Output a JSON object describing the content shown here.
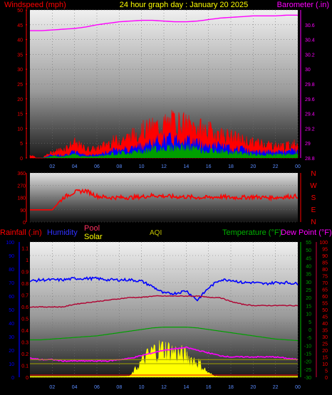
{
  "header": {
    "left_label": "Windspeed (mph)",
    "title": "24 hour graph day : January 20 2025",
    "right_label": "Barometer (.in)"
  },
  "colors": {
    "wind": "#ff0000",
    "gust_fill": "#0000ff",
    "avg_fill": "#00a000",
    "barometer": "#ff00ff",
    "wind_dir": "#ff0000",
    "humidity": "#0000ff",
    "pool": "#b00030",
    "solar": "#ffff00",
    "temperature": "#00a000",
    "dew_point": "#ff00ff",
    "rainfall": "#ffff00",
    "left_axis_text": "#ff0000",
    "rain_axis_text": "#0000ff",
    "temp_axis_text": "#00a000",
    "dew_axis_text": "#ff0000",
    "baro_axis_text": "#ff00ff"
  },
  "chart_data": [
    {
      "type": "area",
      "name": "wind",
      "title": "24 hour graph day : January 20 2025",
      "ylabel": "Windspeed (mph)",
      "y2label": "Barometer (.in)",
      "x_ticks": [
        "02",
        "04",
        "06",
        "08",
        "10",
        "12",
        "14",
        "16",
        "18",
        "20",
        "22",
        "00"
      ],
      "ylim": [
        0,
        50
      ],
      "y_ticks": [
        0,
        5,
        10,
        15,
        20,
        25,
        30,
        35,
        40,
        45,
        50
      ],
      "y2lim": [
        28.8,
        30.8
      ],
      "y2_ticks": [
        "28.8",
        "29",
        "29.2",
        "29.4",
        "29.6",
        "29.8",
        "30",
        "30.2",
        "30.4",
        "30.6"
      ],
      "series": [
        {
          "name": "gust",
          "x": [
            0,
            1,
            2,
            3,
            4,
            5,
            6,
            7,
            8,
            9,
            10,
            11,
            12,
            13,
            14,
            15,
            16,
            17,
            18,
            19,
            20,
            21,
            22,
            23,
            24
          ],
          "values": [
            1,
            0,
            2,
            3,
            5,
            3,
            3,
            5,
            6,
            7,
            9,
            10,
            11,
            12,
            11,
            10,
            9,
            8,
            7,
            6,
            5,
            5,
            4,
            4,
            5
          ]
        },
        {
          "name": "average",
          "x": [
            0,
            1,
            2,
            3,
            4,
            5,
            6,
            7,
            8,
            9,
            10,
            11,
            12,
            13,
            14,
            15,
            16,
            17,
            18,
            19,
            20,
            21,
            22,
            23,
            24
          ],
          "values": [
            0,
            0,
            1,
            1,
            2,
            1,
            1,
            2,
            3,
            3,
            4,
            5,
            6,
            6,
            6,
            5,
            4,
            4,
            3,
            3,
            2,
            2,
            2,
            2,
            3
          ]
        },
        {
          "name": "barometer",
          "x": [
            0,
            1,
            2,
            3,
            4,
            5,
            6,
            7,
            8,
            9,
            10,
            11,
            12,
            13,
            14,
            15,
            16,
            17,
            18,
            19,
            20,
            21,
            22,
            23,
            24
          ],
          "values": [
            30.52,
            30.52,
            30.53,
            30.54,
            30.55,
            30.57,
            30.6,
            30.62,
            30.64,
            30.65,
            30.66,
            30.66,
            30.65,
            30.64,
            30.64,
            30.65,
            30.67,
            30.69,
            30.7,
            30.71,
            30.72,
            30.72,
            30.72,
            30.73,
            30.73
          ]
        }
      ]
    },
    {
      "type": "line",
      "name": "wind_direction",
      "ylim": [
        0,
        360
      ],
      "y_ticks": [
        0,
        90,
        180,
        270,
        360
      ],
      "compass_labels": [
        "N",
        "W",
        "S",
        "E",
        "N"
      ],
      "series": [
        {
          "name": "direction",
          "x": [
            0,
            1,
            2,
            3,
            4,
            5,
            6,
            7,
            8,
            9,
            10,
            11,
            12,
            13,
            14,
            15,
            16,
            17,
            18,
            19,
            20,
            21,
            22,
            23,
            24
          ],
          "values": [
            90,
            90,
            90,
            180,
            220,
            230,
            190,
            180,
            180,
            180,
            185,
            195,
            190,
            185,
            185,
            180,
            180,
            185,
            180,
            180,
            185,
            180,
            180,
            185,
            190
          ]
        }
      ]
    },
    {
      "type": "line",
      "name": "climate",
      "labels": {
        "rainfall": "Rainfall (.in)",
        "humidity": "Humidity",
        "pool": "Pool",
        "solar": "Solar",
        "aqi": "AQI",
        "temperature": "Temperature (°F)",
        "dew_point": "Dew Point (°F)"
      },
      "x_ticks": [
        "02",
        "04",
        "06",
        "08",
        "10",
        "12",
        "14",
        "16",
        "18",
        "20",
        "22",
        "00"
      ],
      "rain_ticks": [
        "0",
        "0.1",
        "0.2",
        "0.3",
        "0.4",
        "0.5",
        "0.6",
        "0.7",
        "0.8",
        "0.9",
        "1",
        "1.1"
      ],
      "humidity_ticks": [
        "0",
        "10",
        "20",
        "30",
        "40",
        "50",
        "60",
        "70",
        "80",
        "90",
        "100"
      ],
      "temp_ticks": [
        "-30",
        "-25",
        "-20",
        "-15",
        "-10",
        "-5",
        "0",
        "5",
        "10",
        "15",
        "20",
        "25",
        "30",
        "35",
        "40",
        "45",
        "50",
        "55"
      ],
      "dew_ticks": [
        "0",
        "5",
        "10",
        "15",
        "20",
        "25",
        "30",
        "35",
        "40",
        "45",
        "50",
        "55",
        "60",
        "65",
        "70",
        "75",
        "80",
        "85",
        "90",
        "95",
        "100"
      ],
      "humidity_lim": [
        0,
        100
      ],
      "temp_lim": [
        -30,
        55
      ],
      "series": [
        {
          "name": "humidity",
          "x": [
            0,
            1,
            2,
            3,
            4,
            5,
            6,
            7,
            8,
            9,
            10,
            11,
            12,
            13,
            14,
            15,
            16,
            17,
            18,
            19,
            20,
            21,
            22,
            23,
            24
          ],
          "values": [
            71,
            72,
            72,
            72,
            73,
            73,
            73,
            72,
            72,
            72,
            71,
            67,
            62,
            62,
            64,
            57,
            66,
            72,
            72,
            70,
            70,
            69,
            70,
            70,
            69
          ]
        },
        {
          "name": "pool",
          "x": [
            0,
            1,
            2,
            3,
            4,
            5,
            6,
            7,
            8,
            9,
            10,
            11,
            12,
            13,
            14,
            15,
            16,
            17,
            18,
            19,
            20,
            21,
            22,
            23,
            24
          ],
          "values": [
            52,
            52,
            52,
            52,
            54,
            55,
            56,
            57,
            58,
            59,
            59,
            60,
            60,
            60,
            60,
            60,
            59,
            59,
            56,
            54,
            53,
            53,
            53,
            53,
            53
          ]
        },
        {
          "name": "temperature",
          "x": [
            0,
            1,
            2,
            3,
            4,
            5,
            6,
            7,
            8,
            9,
            10,
            11,
            12,
            13,
            14,
            15,
            16,
            17,
            18,
            19,
            20,
            21,
            22,
            23,
            24
          ],
          "values": [
            -6.5,
            -6.5,
            -6,
            -5.5,
            -5,
            -4.5,
            -4,
            -3,
            -2,
            -1,
            0,
            1,
            1.5,
            1.5,
            1.5,
            1,
            0,
            -1,
            -2,
            -3,
            -4,
            -5,
            -6,
            -6.5,
            -7
          ]
        },
        {
          "name": "dew_point",
          "x": [
            0,
            1,
            2,
            3,
            4,
            5,
            6,
            7,
            8,
            9,
            10,
            11,
            12,
            13,
            14,
            15,
            16,
            17,
            18,
            19,
            20,
            21,
            22,
            23,
            24
          ],
          "values": [
            14,
            13,
            13,
            12,
            12,
            12,
            12,
            12,
            13,
            14,
            16,
            18,
            20,
            21,
            22,
            20,
            18,
            16,
            15,
            15,
            15,
            15,
            15,
            14,
            13
          ]
        },
        {
          "name": "solar",
          "x": [
            0,
            1,
            2,
            3,
            4,
            5,
            6,
            7,
            8,
            9,
            10,
            11,
            12,
            13,
            14,
            15,
            16,
            17,
            18,
            19,
            20,
            21,
            22,
            23,
            24
          ],
          "values": [
            0,
            0,
            0,
            0,
            0,
            0,
            0,
            0,
            0,
            1,
            12,
            20,
            22,
            19,
            16,
            12,
            3,
            0,
            0,
            0,
            0,
            0,
            0,
            0,
            0
          ]
        },
        {
          "name": "rainfall",
          "x": [
            0,
            24
          ],
          "values": [
            0,
            0
          ]
        }
      ]
    }
  ]
}
